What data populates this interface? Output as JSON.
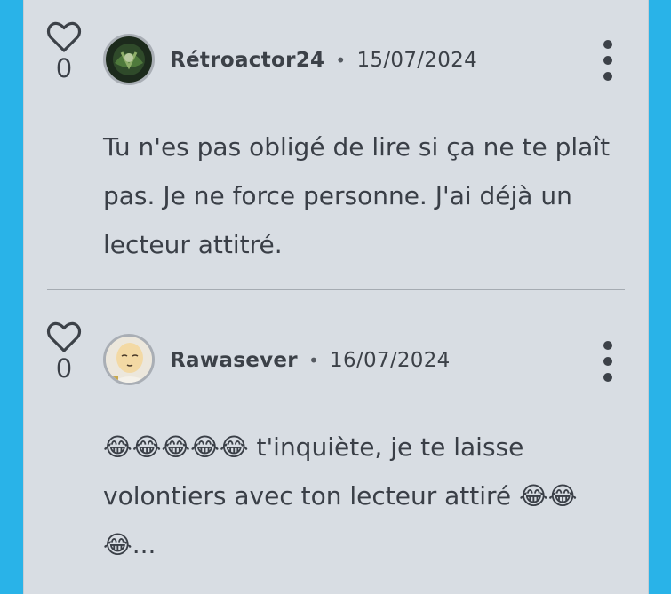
{
  "comments": [
    {
      "author": "Rétroactor24",
      "separator": "•",
      "date": "15/07/2024",
      "likes": "0",
      "text": "Tu n'es pas obligé de lire si ça ne te plaît pas. Je ne force personne. J'ai déjà un lecteur attitré."
    },
    {
      "author": "Rawasever",
      "separator": "•",
      "date": "16/07/2024",
      "likes": "0",
      "text": "😂😂😂😂😂 t'inquiète, je te laisse volontiers avec ton lecteur attiré 😂😂😂..."
    }
  ],
  "colors": {
    "background": "#29b3e8",
    "panel": "#d8dde3",
    "text": "#3a3f47"
  },
  "icons": {
    "like": "heart-outline-icon",
    "menu": "more-vertical-icon"
  }
}
